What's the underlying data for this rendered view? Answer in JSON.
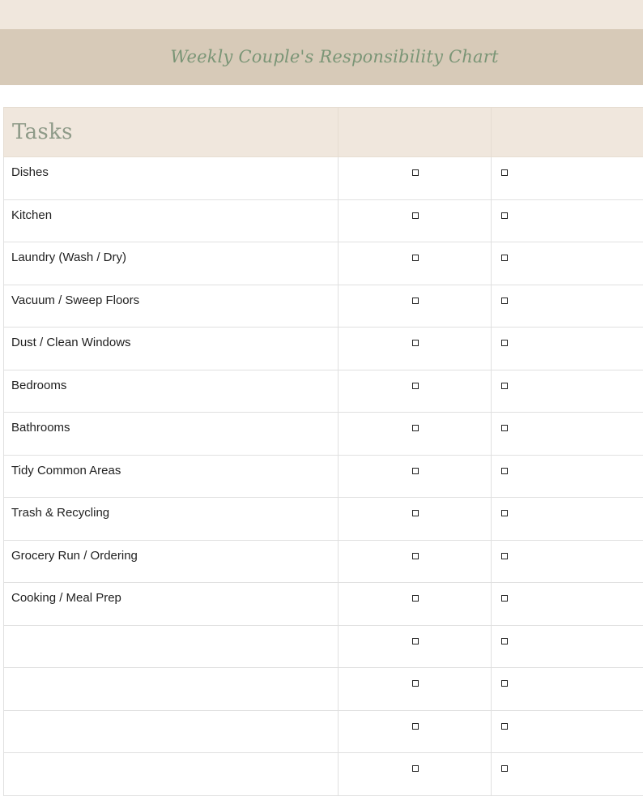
{
  "header": {
    "title": "Weekly Couple's Responsibility Chart"
  },
  "table": {
    "tasks_header": "Tasks",
    "rows": [
      {
        "task": "Dishes"
      },
      {
        "task": "Kitchen"
      },
      {
        "task": "Laundry (Wash / Dry)"
      },
      {
        "task": "Vacuum / Sweep Floors"
      },
      {
        "task": "Dust / Clean Windows"
      },
      {
        "task": "Bedrooms"
      },
      {
        "task": "Bathrooms"
      },
      {
        "task": "Tidy Common Areas"
      },
      {
        "task": "Trash & Recycling"
      },
      {
        "task": "Grocery Run / Ordering"
      },
      {
        "task": "Cooking / Meal Prep"
      },
      {
        "task": ""
      },
      {
        "task": ""
      },
      {
        "task": ""
      },
      {
        "task": ""
      }
    ]
  },
  "colors": {
    "top_band": "#f0e7dd",
    "title_band": "#d7cab8",
    "title_text": "#7a9576",
    "header_row": "#f0e7dd",
    "grid": "#e0e0e0"
  }
}
